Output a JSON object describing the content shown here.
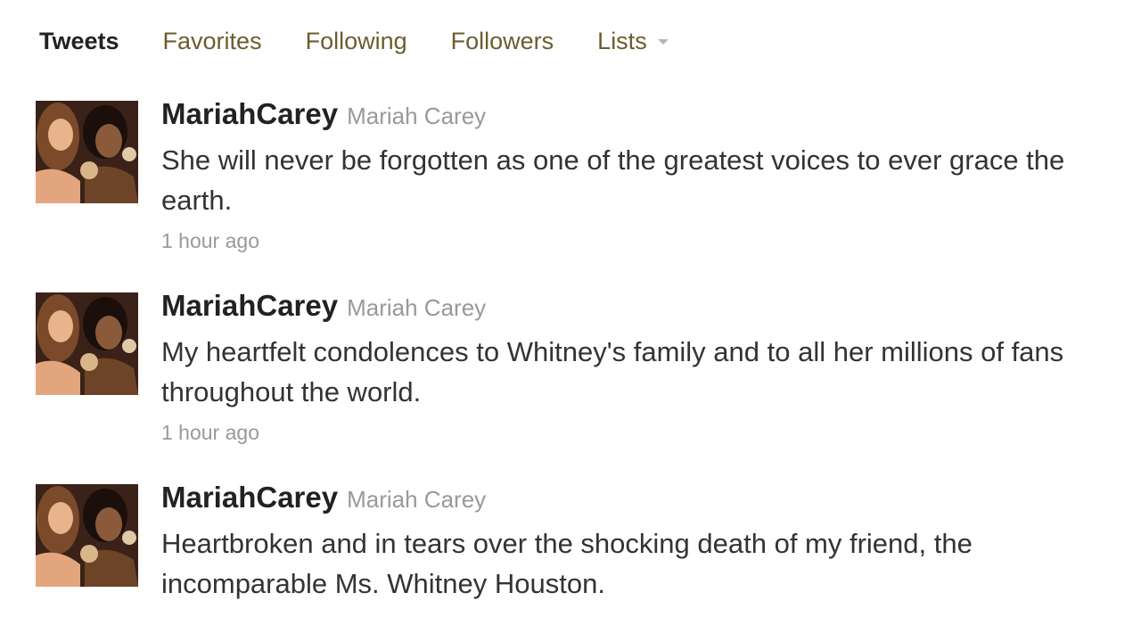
{
  "tabs": {
    "tweets": "Tweets",
    "favorites": "Favorites",
    "following": "Following",
    "followers": "Followers",
    "lists": "Lists"
  },
  "tweets": [
    {
      "screen_name": "MariahCarey",
      "full_name": "Mariah Carey",
      "text": "She will never be forgotten as one of the greatest voices to ever grace the earth.",
      "time": "1 hour ago"
    },
    {
      "screen_name": "MariahCarey",
      "full_name": "Mariah Carey",
      "text": "My heartfelt condolences to Whitney's family and to all her millions of fans throughout the world.",
      "time": "1 hour ago"
    },
    {
      "screen_name": "MariahCarey",
      "full_name": "Mariah Carey",
      "text": "Heartbroken and in tears over the shocking death of my friend, the incomparable Ms. Whitney Houston."
    }
  ]
}
